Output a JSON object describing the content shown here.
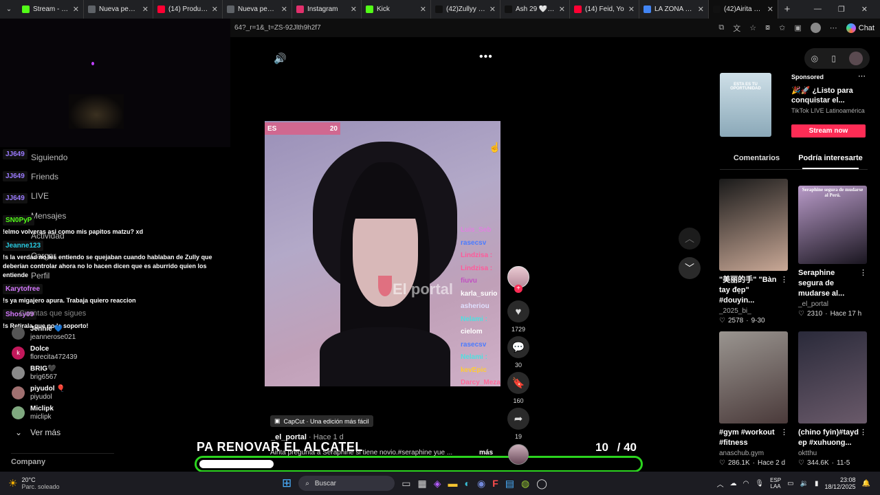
{
  "tabs": [
    {
      "title": "Stream - Kick Dash",
      "color": "#53fc18",
      "active": false
    },
    {
      "title": "Nueva pestaña",
      "color": "#5f6368",
      "active": false
    },
    {
      "title": "(14) Producciones",
      "color": "#ff0033",
      "active": false
    },
    {
      "title": "Nueva pestaña",
      "color": "#5f6368",
      "active": false
    },
    {
      "title": "Instagram",
      "color": "#e1306c",
      "active": false
    },
    {
      "title": "Kick",
      "color": "#53fc18",
      "active": false
    },
    {
      "title": "(42)Zullyy (@zully",
      "color": "#111111",
      "active": false
    },
    {
      "title": "Ash 29 🤍 (@ash",
      "color": "#111111",
      "active": false
    },
    {
      "title": "(14) Feid, Yo",
      "color": "#ff0033",
      "active": false
    },
    {
      "title": "LA ZONA - Búsqu",
      "color": "#4285f4",
      "active": false
    },
    {
      "title": "(42)Airita pregunt",
      "color": "#111111",
      "active": true
    }
  ],
  "url": "64?_r=1&_t=ZS-92Jlth9h2f7",
  "chat_label": "Chat",
  "chat": {
    "messages": [
      {
        "user": "JJ649",
        "text": "",
        "color": "#9b7bff"
      },
      {
        "user": "JJ649",
        "text": "",
        "color": "#9b7bff"
      },
      {
        "user": "JJ649",
        "text": "",
        "color": "#9b7bff"
      },
      {
        "user": "SN0PyP",
        "text": "!elmo volveras asi como mis papitos matzu? xd",
        "color": "#53fc18"
      },
      {
        "user": "Jeanne123",
        "text": "!s la verdad no les entiendo se quejaban cuando hablaban de Zully que deberían controlar ahora no lo hacen dicen que es aburrido quien los entiende",
        "color": "#27c9e0"
      },
      {
        "user": "Karytofree",
        "text": "!s ya migajero apura. Trabaja quiero reaccion",
        "color": "#d679ff"
      },
      {
        "user": "Shosy09",
        "text": "!s Retirala que no la soporto!",
        "color": "#d679ff"
      }
    ],
    "ghost_nav": [
      "Siguiendo",
      "Friends",
      "LIVE",
      "Mensajes",
      "Actividad",
      "Cargar",
      "Perfil"
    ],
    "following_header": "Cuentas que sigues",
    "following": [
      {
        "name": "Jennie 💙",
        "handle": "jeannerose021",
        "color": "#555"
      },
      {
        "name": "Dolce",
        "handle": "florecita472439",
        "color": "#c2185b",
        "letter": "k"
      },
      {
        "name": "BRIG🖤",
        "handle": "brig6567",
        "color": "#8a8a8a"
      },
      {
        "name": "piyudol 🎈",
        "handle": "piyudol",
        "color": "#a07070"
      },
      {
        "name": "Miclipk",
        "handle": "miclipk",
        "color": "#7fa87f"
      }
    ],
    "see_more": "Ver más",
    "company": "Company"
  },
  "video": {
    "banner_value": "20",
    "banner_prefix": "ES",
    "watermark": "El portal",
    "capcut": "CapCut · Una edición más fácil",
    "author": "_el_portal",
    "time_ago": "Hace 1 d",
    "caption": "Airita pregunta a Seraphine si tiene novio.#seraphine yue ...",
    "more": "más",
    "overlay_title": "PA RENOVAR EL ALCATEL",
    "counter_current": "10",
    "counter_total": "/ 40",
    "progress": 0.17,
    "stream_chat": [
      {
        "name": "Luis_Seb",
        "color": "#e080e0"
      },
      {
        "name": "rasecsv",
        "color": "#4a7bff"
      },
      {
        "name": "Lindzisa :",
        "color": "#ff5a9a"
      },
      {
        "name": "Lindzisa :",
        "color": "#ff5a9a"
      },
      {
        "name": "fiuvu",
        "color": "#c050c0"
      },
      {
        "name": "karla_surio",
        "color": "#ffffff"
      },
      {
        "name": "asheriou",
        "color": "#e0e0ff"
      },
      {
        "name": "Nelami :",
        "color": "#4de0e0"
      },
      {
        "name": "cielom",
        "color": "#ffffff"
      },
      {
        "name": "rasecsv",
        "color": "#4a7bff"
      },
      {
        "name": "Nelami :",
        "color": "#4de0e0"
      },
      {
        "name": "kevEpic",
        "color": "#ffcc33"
      },
      {
        "name": "Darcy_Meza",
        "color": "#ff6a9a"
      }
    ]
  },
  "actions": {
    "likes": "1729",
    "comments": "30",
    "saves": "160",
    "shares": "19"
  },
  "sponsored": {
    "label": "Sponsored",
    "title": "🎉🚀 ¿Listo para conquistar el...",
    "subtitle": "TikTok LIVE Latinoamérica",
    "cta": "Stream now",
    "ad_text": "ESTA ES TU OPORTUNIDAD"
  },
  "right_tabs": [
    "Comentarios",
    "Podría interesarte"
  ],
  "cards": [
    {
      "title": "\"美丽的手\" \"Bàn tay đẹp\" #douyin...",
      "author": "_2025_bi_",
      "likes": "2578",
      "date": "9-30",
      "c1": "#1a1a1a",
      "c2": "#c9a896"
    },
    {
      "title": "Seraphine segura de mudarse al...",
      "author": "_el_portal",
      "likes": "2310",
      "date": "Hace 17 h",
      "c1": "#b99bc9",
      "c2": "#1a1620",
      "thumb_text": "Seraphine segura de mudarse al Perú."
    },
    {
      "title": "#gym #workout #fitness",
      "author": "anaschub.gym",
      "likes": "286.1K",
      "date": "Hace 2 d",
      "c1": "#9a9590",
      "c2": "#4a3a3a"
    },
    {
      "title": "(chino fyin)#tayd ep #xuhuong...",
      "author": "oktthu",
      "likes": "344.6K",
      "date": "11-5",
      "c1": "#2a2a3a",
      "c2": "#6a5a6a"
    }
  ],
  "taskbar": {
    "temp": "20°C",
    "weather": "Parc. soleado",
    "search": "Buscar",
    "lang": "ESP",
    "lang2": "LAA",
    "time": "23:08",
    "date": "18/12/2025"
  }
}
